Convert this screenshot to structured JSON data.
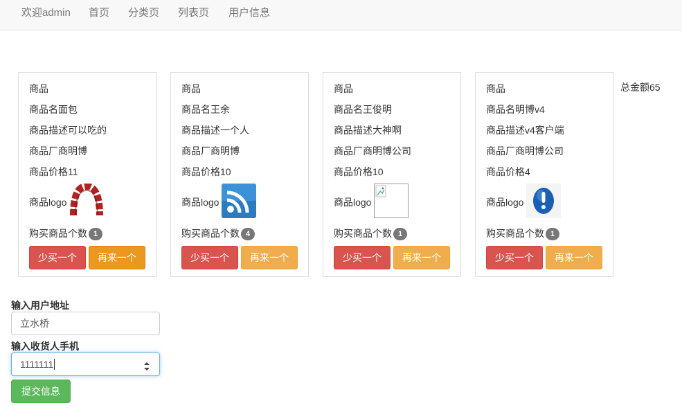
{
  "nav": {
    "welcome": "欢迎admin",
    "links": [
      "首页",
      "分类页",
      "列表页",
      "用户信息"
    ]
  },
  "products": [
    {
      "header": "商品",
      "name": "商品名面包",
      "desc": "商品描述可以吃的",
      "maker": "商品厂商明博",
      "price": "商品价格11",
      "logo_label": "商品logo",
      "logo_icon": "redmine-arch-icon",
      "count_label": "购买商品个数",
      "count": "1",
      "less_label": "少买一个",
      "more_label": "再来一个"
    },
    {
      "header": "商品",
      "name": "商品名王余",
      "desc": "商品描述一个人",
      "maker": "商品厂商明博",
      "price": "商品价格10",
      "logo_label": "商品logo",
      "logo_icon": "rss-feed-icon",
      "count_label": "购买商品个数",
      "count": "4",
      "less_label": "少买一个",
      "more_label": "再来一个"
    },
    {
      "header": "商品",
      "name": "商品名王俊明",
      "desc": "商品描述大神啊",
      "maker": "商品厂商明博公司",
      "price": "商品价格10",
      "logo_label": "商品logo",
      "logo_icon": "broken-image-icon",
      "count_label": "购买商品个数",
      "count": "1",
      "less_label": "少买一个",
      "more_label": "再来一个"
    },
    {
      "header": "商品",
      "name": "商品名明博v4",
      "desc": "商品描述v4客户端",
      "maker": "商品厂商明博公司",
      "price": "商品价格4",
      "logo_label": "商品logo",
      "logo_icon": "exclamation-info-icon",
      "count_label": "购买商品个数",
      "count": "1",
      "less_label": "少买一个",
      "more_label": "再来一个"
    }
  ],
  "total": "总金额65",
  "form": {
    "address_label": "输入用户地址",
    "address_value": "立水桥",
    "phone_label": "输入收货人手机",
    "phone_value": "1111111",
    "submit_label": "提交信息"
  },
  "colors": {
    "danger": "#d9534f",
    "warning": "#f0ad4e",
    "success": "#5cb85c",
    "badge": "#777777"
  }
}
